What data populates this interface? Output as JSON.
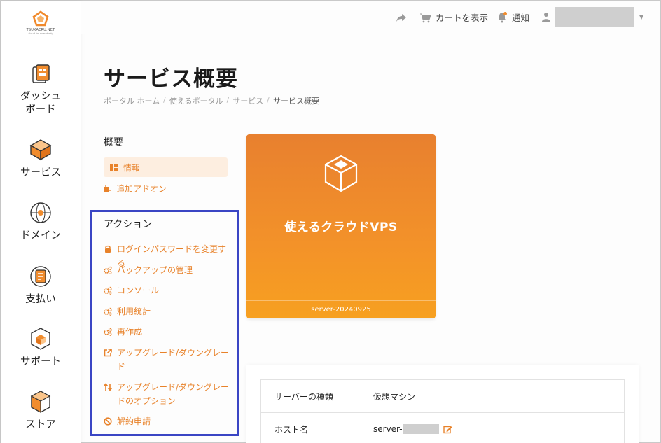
{
  "logo": {
    "text": "TSUKAERU.NET",
    "sub": "cloud for everybody"
  },
  "sidebar": {
    "items": [
      {
        "label": "ダッシュ\nボード",
        "line1": "ダッシュ",
        "line2": "ボード",
        "icon": "dashboard-icon"
      },
      {
        "label": "サービス",
        "icon": "services-box-icon"
      },
      {
        "label": "ドメイン",
        "icon": "domain-globe-icon"
      },
      {
        "label": "支払い",
        "icon": "billing-icon"
      },
      {
        "label": "サポート",
        "icon": "support-icon"
      },
      {
        "label": "ストア",
        "icon": "store-icon"
      }
    ]
  },
  "header": {
    "cart_label": "カートを表示",
    "notify_label": "通知"
  },
  "page": {
    "title": "サービス概要",
    "breadcrumb": [
      "ポータル ホーム",
      "使えるポータル",
      "サービス",
      "サービス概要"
    ]
  },
  "menu": {
    "overview_heading": "概要",
    "info_label": "情報",
    "addon_label": "追加アドオン",
    "actions_heading": "アクション",
    "actions": [
      {
        "label": "ログインパスワードを変更する",
        "icon": "lock-icon"
      },
      {
        "label": "バックアップの管理",
        "icon": "gears-icon"
      },
      {
        "label": "コンソール",
        "icon": "gears-icon"
      },
      {
        "label": "利用統計",
        "icon": "gears-icon"
      },
      {
        "label": "再作成",
        "icon": "gears-icon"
      },
      {
        "label": "アップグレード/ダウングレード",
        "icon": "external-link-icon"
      },
      {
        "label": "アップグレード/ダウングレードのオプション",
        "icon": "sort-arrows-icon"
      },
      {
        "label": "解約申請",
        "icon": "ban-icon"
      }
    ]
  },
  "product": {
    "name": "使えるクラウドVPS",
    "server": "server-20240925"
  },
  "info_table": {
    "rows": [
      {
        "label": "サーバーの種類",
        "value": "仮想マシン"
      },
      {
        "label": "ホスト名",
        "value": "server-"
      }
    ]
  },
  "colors": {
    "accent": "#e8822a",
    "card_top": "#e8802f",
    "card_bottom": "#f7a020",
    "highlight_border": "#3a45c4",
    "active_bg": "#fdeee0"
  }
}
